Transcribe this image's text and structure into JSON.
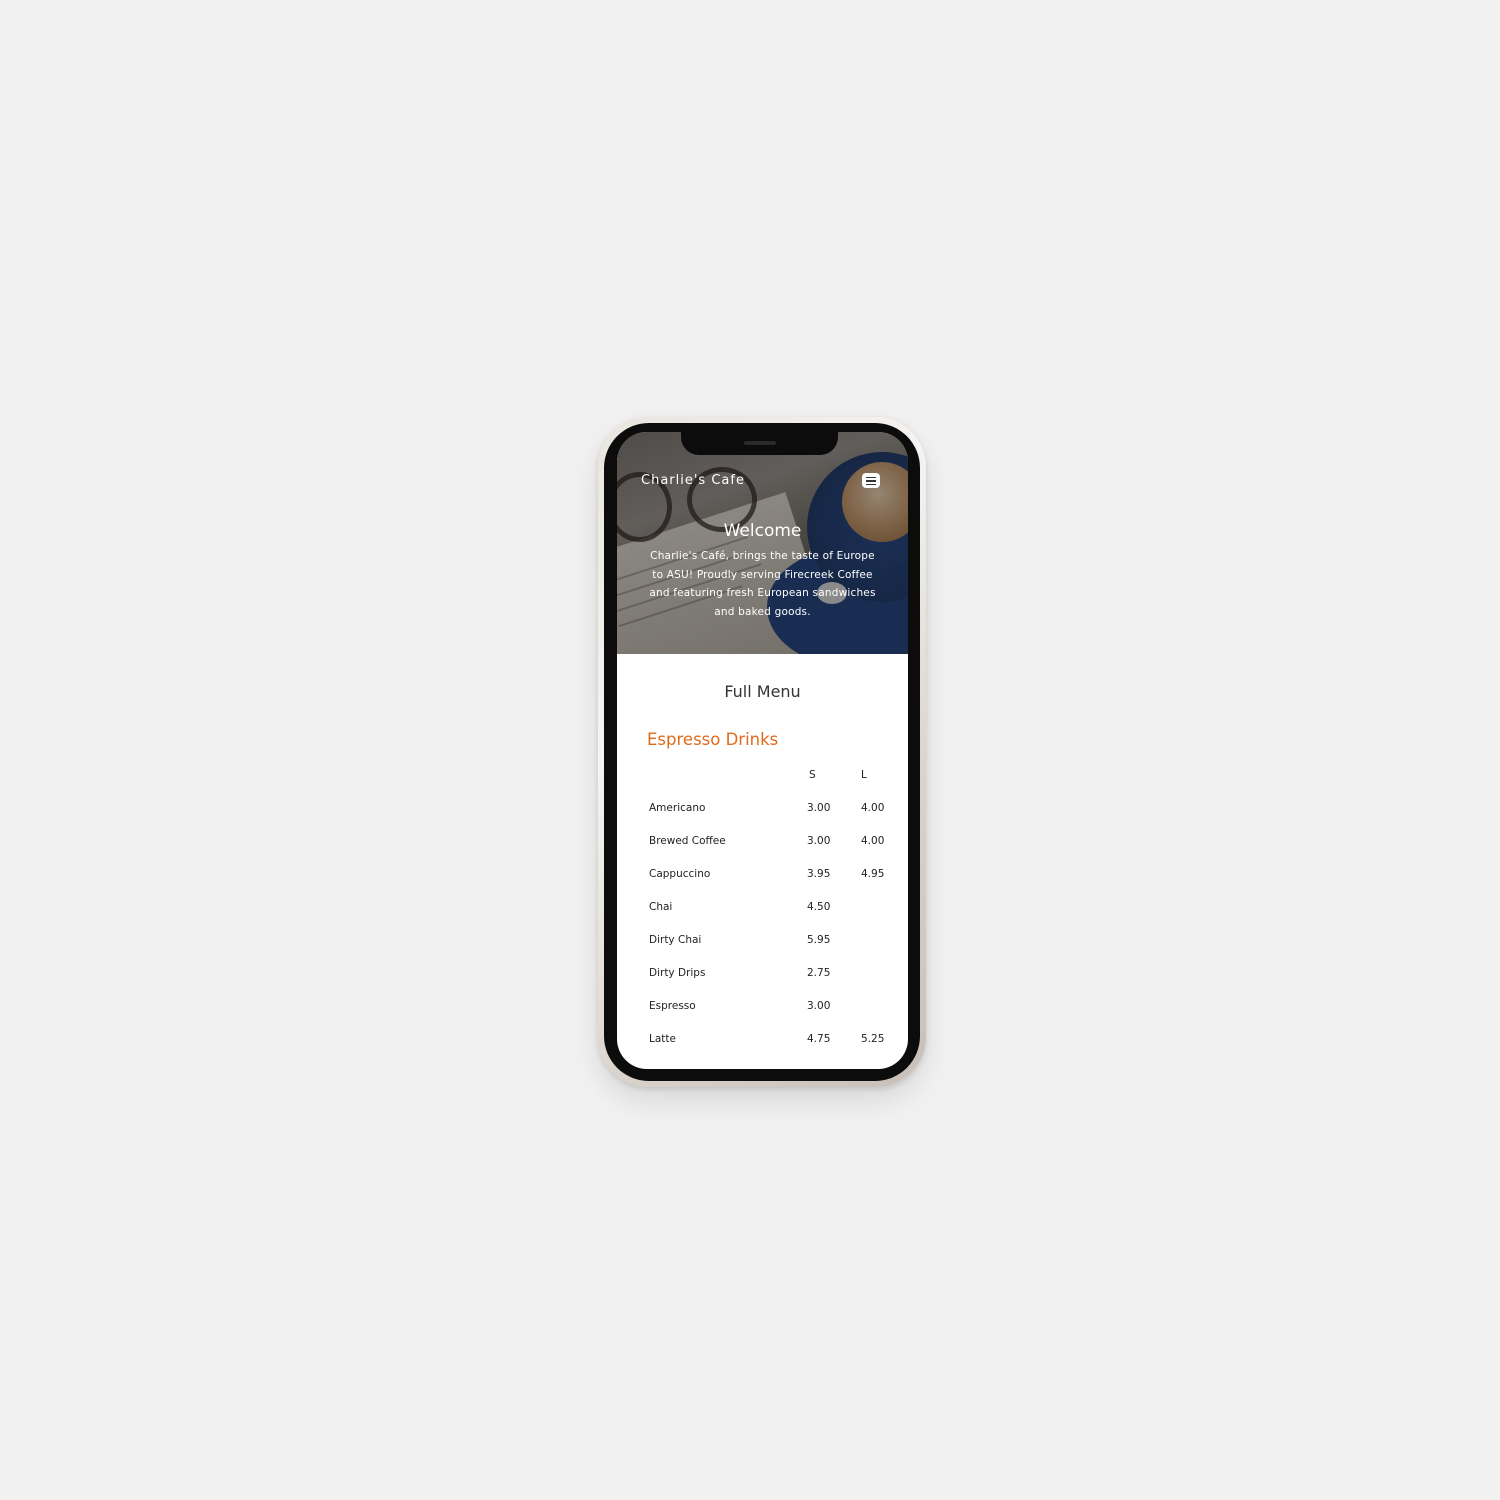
{
  "header": {
    "brand": "Charlie's Cafe",
    "menu_icon": "hamburger-icon"
  },
  "hero": {
    "title": "Welcome",
    "text": "Charlie's Café, brings the taste of Europe to ASU! Proudly serving Firecreek Coffee and featuring fresh European sandwiches and baked goods."
  },
  "menu": {
    "heading": "Full Menu",
    "section_title": "Espresso Drinks",
    "columns": {
      "small": "S",
      "large": "L"
    },
    "items": [
      {
        "name": "Americano",
        "s": "3.00",
        "l": "4.00"
      },
      {
        "name": "Brewed Coffee",
        "s": "3.00",
        "l": "4.00"
      },
      {
        "name": "Cappuccino",
        "s": "3.95",
        "l": "4.95"
      },
      {
        "name": "Chai",
        "s": "4.50",
        "l": ""
      },
      {
        "name": "Dirty Chai",
        "s": "5.95",
        "l": ""
      },
      {
        "name": "Dirty Drips",
        "s": "2.75",
        "l": ""
      },
      {
        "name": "Espresso",
        "s": "3.00",
        "l": ""
      },
      {
        "name": "Latte",
        "s": "4.75",
        "l": "5.25"
      }
    ]
  },
  "colors": {
    "accent": "#e06a1c",
    "background": "#f1f1f1"
  }
}
